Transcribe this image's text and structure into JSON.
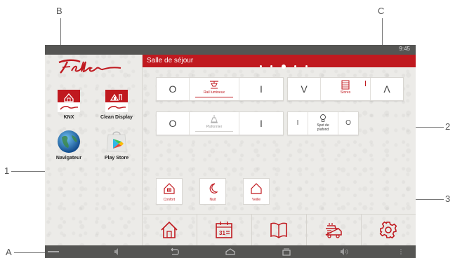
{
  "callouts": {
    "A": "A",
    "B": "B",
    "C": "C",
    "one": "1",
    "two": "2",
    "three": "3"
  },
  "status_bar": {
    "clock": "9:45"
  },
  "apps": [
    {
      "label": "KNX",
      "icon": "knx-house-icon"
    },
    {
      "label": "Clean Display",
      "icon": "clean-display-icon"
    },
    {
      "label": "Navigateur",
      "icon": "globe-icon"
    },
    {
      "label": "Play Store",
      "icon": "play-store-icon"
    }
  ],
  "header": {
    "room_title": "Salle de séjour",
    "page_count": 5,
    "active_page": 3
  },
  "controls": {
    "rail": {
      "label": "Rail lumineux",
      "off_glyph": "O",
      "on_glyph": "I"
    },
    "stores": {
      "label": "Stores",
      "down_glyph": "V",
      "up_glyph": "Λ"
    },
    "plafonnier": {
      "label": "Plafonnier",
      "off_glyph": "O",
      "on_glyph": "I"
    },
    "spot": {
      "label_line1": "Spot de",
      "label_line2": "plafond",
      "on_glyph": "I",
      "off_glyph": "O"
    }
  },
  "scenes": [
    {
      "label": "Confort",
      "icon": "house-icon"
    },
    {
      "label": "Nuit",
      "icon": "moon-icon"
    },
    {
      "label": "Veille",
      "icon": "house-outline-icon"
    }
  ],
  "bottom_tabs": [
    {
      "name": "home",
      "icon": "home-icon"
    },
    {
      "name": "calendar",
      "icon": "calendar-icon",
      "text": "31"
    },
    {
      "name": "book",
      "icon": "book-icon"
    },
    {
      "name": "vehicle",
      "icon": "vehicle-icon"
    },
    {
      "name": "settings",
      "icon": "gear-icon"
    }
  ],
  "colors": {
    "accent": "#c0191f",
    "bars": "#555553",
    "background": "#ecebe8"
  }
}
